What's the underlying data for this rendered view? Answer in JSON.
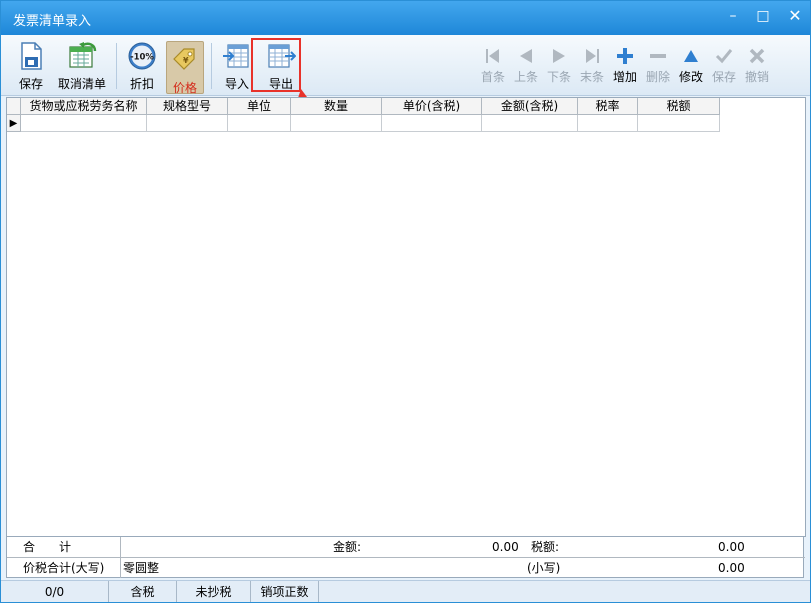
{
  "window": {
    "title": "发票清单录入",
    "controls": [
      "–",
      "□",
      "✕"
    ]
  },
  "toolbar": {
    "save": "保存",
    "cancel_list": "取消清单",
    "discount": "折扣",
    "discount_badge": "-10%",
    "price": "价格",
    "import": "导入",
    "export": "导出"
  },
  "nav": {
    "first": "首条",
    "prev": "上条",
    "next": "下条",
    "last": "末条",
    "add": "增加",
    "delete": "删除",
    "edit": "修改",
    "save": "保存",
    "undo": "撤销"
  },
  "table": {
    "columns": [
      "货物或应税劳务名称",
      "规格型号",
      "单位",
      "数量",
      "单价(含税)",
      "金额(含税)",
      "税率",
      "税额"
    ],
    "rows": [
      [
        "",
        "",
        "",
        "",
        "",
        "",
        "",
        ""
      ]
    ]
  },
  "totals": {
    "sum_label": "合　　计",
    "amount_label": "金额:",
    "amount_value": "0.00",
    "tax_label": "税额:",
    "tax_value": "0.00",
    "total_upper_label": "价税合计(大写)",
    "total_upper_value": "零圆整",
    "total_lower_label": "(小写)",
    "total_lower_value": "0.00"
  },
  "status": {
    "count": "0/0",
    "tax_included": "含税",
    "not_reported": "未抄税",
    "sale_type": "销项正数"
  },
  "colors": {
    "accent": "#1e87d8",
    "highlight": "#e8322a"
  }
}
